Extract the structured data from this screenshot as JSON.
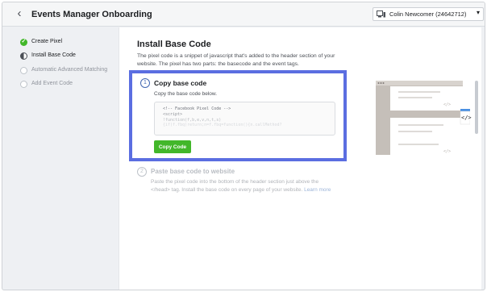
{
  "header": {
    "title": "Events Manager Onboarding",
    "account_name": "Colin Newcomer (24642712)"
  },
  "sidebar": {
    "steps": [
      {
        "label": "Create Pixel",
        "state": "done"
      },
      {
        "label": "Install Base Code",
        "state": "current"
      },
      {
        "label": "Automatic Advanced Matching",
        "state": "todo"
      },
      {
        "label": "Add Event Code",
        "state": "todo"
      }
    ]
  },
  "main": {
    "title": "Install Base Code",
    "description": "The pixel code is a snippet of javascript that's added to the header section of your website. The pixel has two parts: the basecode and the event tags.",
    "step1": {
      "number": "1",
      "title": "Copy base code",
      "subtitle": "Copy the base code below.",
      "code_lines": [
        "<!-- Facebook Pixel Code -->",
        "<script>",
        "!function(f,b,e,v,n,t,s)",
        "{if(f.fbq)return;n=f.fbq=function(){n.callMethod?"
      ],
      "button_label": "Copy Code"
    },
    "step2": {
      "number": "2",
      "title": "Paste base code to website",
      "description": "Paste the pixel code into the bottom of the header section just above the </head> tag. Install the base code on every page of your website.",
      "link_text": "Learn more"
    },
    "illustration": {
      "tag_text": "</>",
      "accent": "#4a90e2"
    }
  },
  "colors": {
    "highlight": "#5b6ee1",
    "primary_button": "#42b72a",
    "step_active": "#4267b2"
  }
}
